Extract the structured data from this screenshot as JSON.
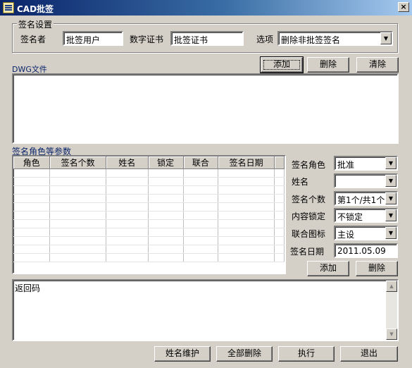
{
  "window": {
    "title": "CAD批签",
    "close_label": "×"
  },
  "signature_settings": {
    "group_label": "签名设置",
    "signer_label": "签名者",
    "signer_value": "批签用户",
    "cert_label": "数字证书",
    "cert_value": "批签证书",
    "option_label": "选项",
    "option_value": "删除非批签签名"
  },
  "dwg": {
    "label": "DWG文件",
    "add_label": "添加",
    "delete_label": "删除",
    "clear_label": "清除"
  },
  "roles": {
    "label": "签名角色等参数",
    "columns": [
      "角色",
      "签名个数",
      "姓名",
      "锁定",
      "联合",
      "签名日期"
    ],
    "rows": [
      [
        "",
        "",
        "",
        "",
        "",
        "",
        ""
      ],
      [
        "",
        "",
        "",
        "",
        "",
        "",
        ""
      ],
      [
        "",
        "",
        "",
        "",
        "",
        "",
        ""
      ],
      [
        "",
        "",
        "",
        "",
        "",
        "",
        ""
      ],
      [
        "",
        "",
        "",
        "",
        "",
        "",
        ""
      ],
      [
        "",
        "",
        "",
        "",
        "",
        "",
        ""
      ],
      [
        "",
        "",
        "",
        "",
        "",
        "",
        ""
      ],
      [
        "",
        "",
        "",
        "",
        "",
        "",
        ""
      ],
      [
        "",
        "",
        "",
        "",
        "",
        "",
        ""
      ],
      [
        "",
        "",
        "",
        "",
        "",
        "",
        ""
      ],
      [
        "",
        "",
        "",
        "",
        "",
        "",
        ""
      ]
    ]
  },
  "params": {
    "role_label": "签名角色",
    "role_value": "批准",
    "name_label": "姓名",
    "name_value": "",
    "count_label": "签名个数",
    "count_value": "第1个/共1个",
    "lock_label": "内容锁定",
    "lock_value": "不锁定",
    "joint_label": "联合图标",
    "joint_value": "主设",
    "date_label": "签名日期",
    "date_value": "2011.05.09",
    "add_label": "添加",
    "delete_label": "删除"
  },
  "return_code": {
    "text": "返回码"
  },
  "footer": {
    "name_maintain_label": "姓名维护",
    "delete_all_label": "全部删除",
    "execute_label": "执行",
    "exit_label": "退出"
  }
}
